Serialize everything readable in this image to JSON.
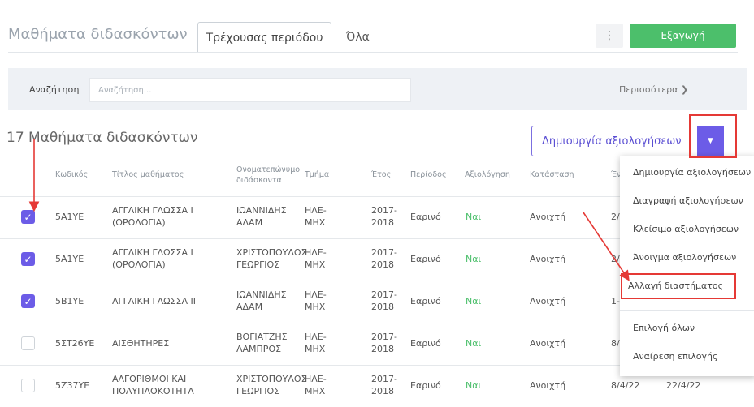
{
  "header": {
    "title": "Μαθήματα διδασκόντων",
    "tabs": [
      "Τρέχουσας περιόδου",
      "Όλα"
    ],
    "kebab": "⋮",
    "export_label": "Εξαγωγή"
  },
  "search": {
    "label": "Αναζήτηση",
    "placeholder": "Αναζήτηση...",
    "more_label": "Περισσότερα ❯"
  },
  "list": {
    "count_title": "17 Μαθήματα διδασκόντων",
    "create_button": "Δημιουργία αξιολογήσεων",
    "caret": "▼"
  },
  "table": {
    "headers": [
      "Κωδικός",
      "Τίτλος μαθήματος",
      "Ονοματεπώνυμο διδάσκοντα",
      "Τμήμα",
      "Έτος",
      "Περίοδος",
      "Αξιολόγηση",
      "Κατάσταση",
      "Έν"
    ],
    "rows": [
      {
        "checked": true,
        "code": "5A1YE",
        "title": [
          "ΑΓΓΛΙΚΗ ΓΛΩΣΣΑ Ι",
          "(ΟΡΟΛΟΓΙΑ)"
        ],
        "teacher": [
          "ΙΩΑΝΝΙΔΗΣ",
          "ΑΔΑΜ"
        ],
        "dept": [
          "ΗΛΕ-",
          "ΜΗΧ"
        ],
        "year": [
          "2017-",
          "2018"
        ],
        "period": "Εαρινό",
        "eval": "Ναι",
        "status": "Ανοιχτή",
        "start": "2/",
        "end": ""
      },
      {
        "checked": true,
        "code": "5A1YE",
        "title": [
          "ΑΓΓΛΙΚΗ ΓΛΩΣΣΑ Ι",
          "(ΟΡΟΛΟΓΙΑ)"
        ],
        "teacher": [
          "ΧΡΙΣΤΟΠΟΥΛΟΣ",
          "ΓΕΩΡΓΙΟΣ"
        ],
        "dept": [
          "ΗΛΕ-",
          "ΜΗΧ"
        ],
        "year": [
          "2017-",
          "2018"
        ],
        "period": "Εαρινό",
        "eval": "Ναι",
        "status": "Ανοιχτή",
        "start": "2/",
        "end": ""
      },
      {
        "checked": true,
        "code": "5B1YE",
        "title": [
          "ΑΓΓΛΙΚΗ ΓΛΩΣΣΑ ΙΙ",
          ""
        ],
        "teacher": [
          "ΙΩΑΝΝΙΔΗΣ",
          "ΑΔΑΜ"
        ],
        "dept": [
          "ΗΛΕ-",
          "ΜΗΧ"
        ],
        "year": [
          "2017-",
          "2018"
        ],
        "period": "Εαρινό",
        "eval": "Ναι",
        "status": "Ανοιχτή",
        "start": "1-",
        "end": ""
      },
      {
        "checked": false,
        "code": "5ΣΤ26ΥΕ",
        "title": [
          "ΑΙΣΘΗΤΗΡΕΣ",
          ""
        ],
        "teacher": [
          "ΒΟΓΙΑΤΖΗΣ",
          "ΛΑΜΠΡΟΣ"
        ],
        "dept": [
          "ΗΛΕ-",
          "ΜΗΧ"
        ],
        "year": [
          "2017-",
          "2018"
        ],
        "period": "Εαρινό",
        "eval": "Ναι",
        "status": "Ανοιχτή",
        "start": "8/",
        "end": ""
      },
      {
        "checked": false,
        "code": "5Ζ37ΥΕ",
        "title": [
          "ΑΛΓΟΡΙΘΜΟΙ ΚΑΙ",
          "ΠΟΛΥΠΛΟΚΟΤΗΤΑ"
        ],
        "teacher": [
          "ΧΡΙΣΤΟΠΟΥΛΟΣ",
          "ΓΕΩΡΓΙΟΣ"
        ],
        "dept": [
          "ΗΛΕ-",
          "ΜΗΧ"
        ],
        "year": [
          "2017-",
          "2018"
        ],
        "period": "Εαρινό",
        "eval": "Ναι",
        "status": "Ανοιχτή",
        "start": "8/4/22",
        "end": "22/4/22"
      }
    ]
  },
  "menu": {
    "items": [
      "Δημιουργία αξιολογήσεων",
      "Διαγραφή αξιολογήσεων",
      "Κλείσιμο αξιολογήσεων",
      "Άνοιγμα αξιολογήσεων",
      "Αλλαγή διαστήματος",
      "Επιλογή όλων",
      "Αναίρεση επιλογής"
    ]
  },
  "colors": {
    "primary": "#6c5ce7",
    "success": "#4cbf6b",
    "annotation": "#e53935"
  },
  "checkmark": "✓"
}
